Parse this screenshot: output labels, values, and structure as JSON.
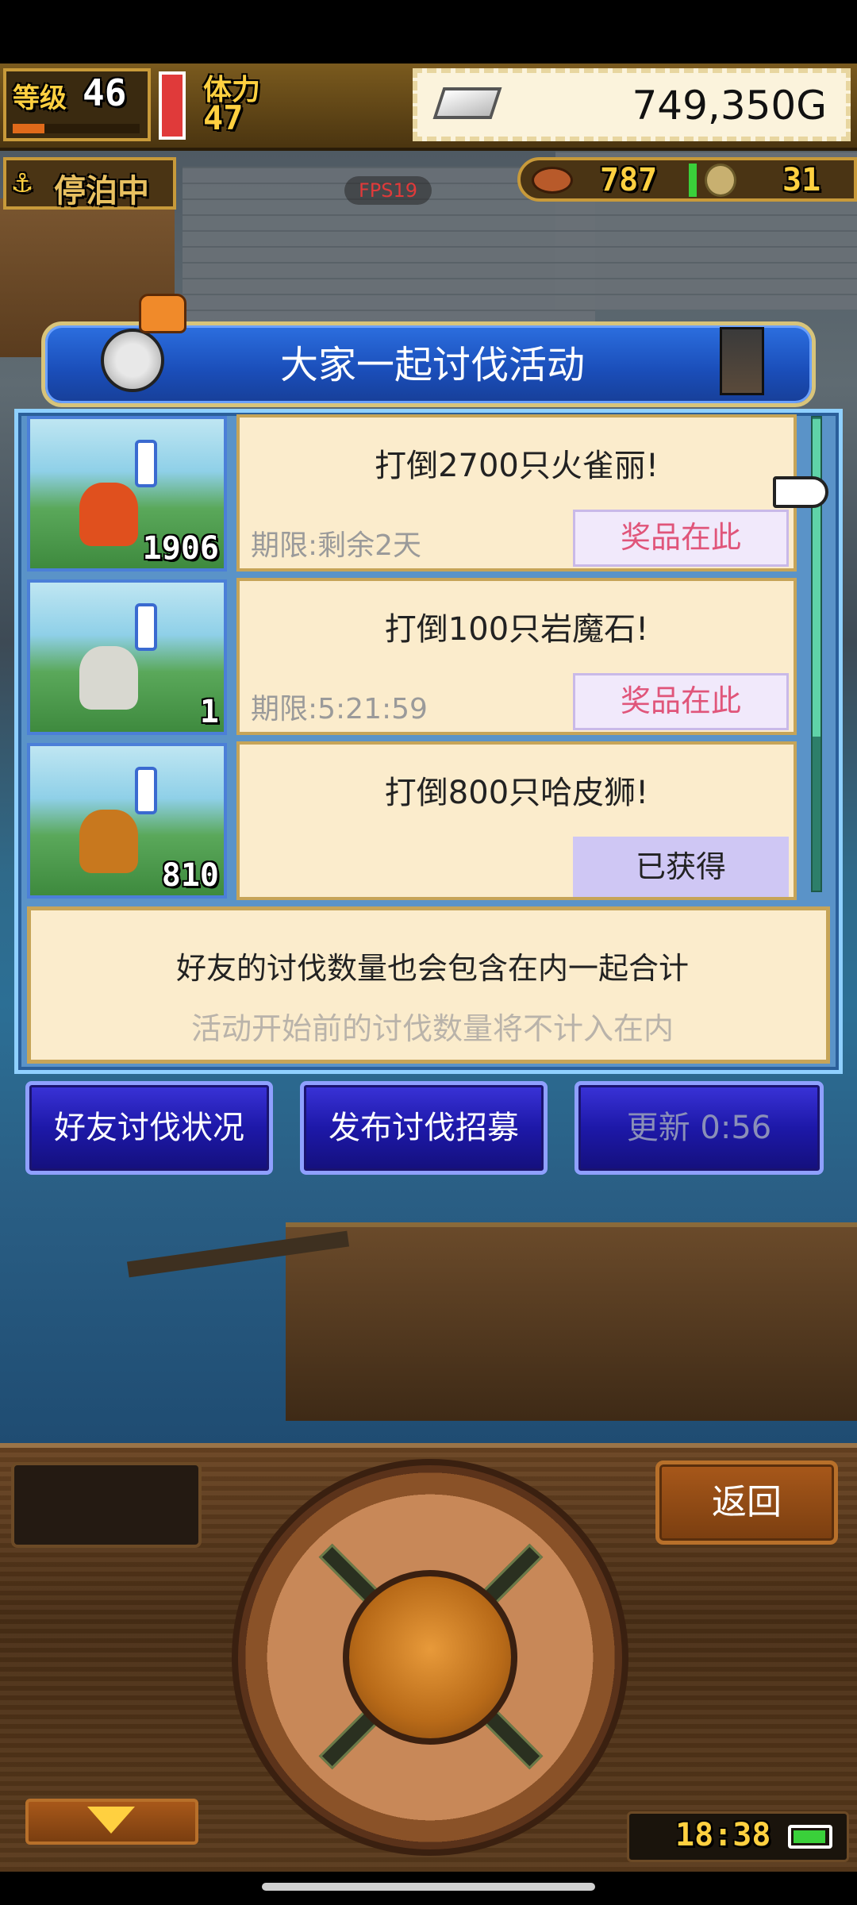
{
  "hud": {
    "level_label": "等级",
    "level_value": "46",
    "stamina_label": "体力",
    "stamina_value": "47",
    "gold": "749,350G",
    "docked_label": "停泊中",
    "fps": "FPS19",
    "food_value": "787",
    "medal_value": "31"
  },
  "dialog": {
    "title": "大家一起讨伐活动",
    "events": [
      {
        "thumb_count": "1906",
        "title": "打倒2700只火雀丽!",
        "deadline": "期限:剩余2天",
        "button": "奖品在此",
        "state": "prize",
        "monster_color": "#e0501e"
      },
      {
        "thumb_count": "1",
        "title": "打倒100只岩魔石!",
        "deadline": "期限:5:21:59",
        "button": "奖品在此",
        "state": "prize",
        "monster_color": "#d8d8d0"
      },
      {
        "thumb_count": "810",
        "title": "打倒800只哈皮狮!",
        "deadline": "",
        "button": "已获得",
        "state": "obtained",
        "monster_color": "#c8781e"
      }
    ],
    "note_primary": "好友的讨伐数量也会包含在内一起合计",
    "note_secondary": "活动开始前的讨伐数量将不计入在内"
  },
  "actions": {
    "friend_status": "好友讨伐状况",
    "post_recruit": "发布讨伐招募",
    "refresh": "更新 0:56"
  },
  "console": {
    "back": "返回",
    "clock": "18:38"
  },
  "icons": {
    "gold": "silver-bar-icon",
    "anchor": "anchor-icon",
    "food": "meat-icon",
    "medal": "medal-icon",
    "pointer": "pointing-hand-icon",
    "down": "down-arrow-icon",
    "battery": "battery-icon"
  },
  "colors": {
    "title_bar": "#1a4db8",
    "card_bg": "#fbeccc",
    "prize_text": "#e0557a",
    "action_button": "#1d18a8",
    "console_wood": "#4a2f16"
  }
}
